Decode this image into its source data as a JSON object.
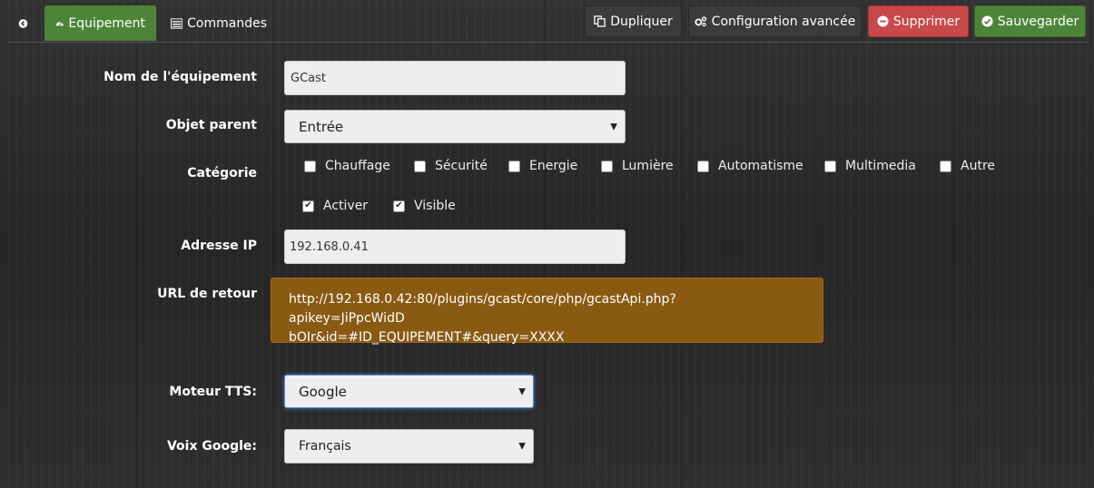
{
  "tabs": {
    "back_label": "",
    "equipment_label": "Equipement",
    "commands_label": "Commandes"
  },
  "toolbar": {
    "duplicate_label": "Dupliquer",
    "advanced_label": "Configuration avancée",
    "delete_label": "Supprimer",
    "save_label": "Sauvegarder"
  },
  "form": {
    "name_label": "Nom de l'équipement",
    "name_value": "GCast",
    "parent_label": "Objet parent",
    "parent_value": "Entrée",
    "category_label": "Catégorie",
    "categories": [
      {
        "label": "Chauffage",
        "checked": false
      },
      {
        "label": "Sécurité",
        "checked": false
      },
      {
        "label": "Energie",
        "checked": false
      },
      {
        "label": "Lumière",
        "checked": false
      },
      {
        "label": "Automatisme",
        "checked": false
      },
      {
        "label": "Multimedia",
        "checked": false
      },
      {
        "label": "Autre",
        "checked": false
      }
    ],
    "activate_label": "Activer",
    "activate_checked": true,
    "visible_label": "Visible",
    "visible_checked": true,
    "ip_label": "Adresse IP",
    "ip_value": "192.168.0.41",
    "url_label": "URL de retour",
    "url_line1": "http://192.168.0.42:80/plugins/gcast/core/php/gcastApi.php?",
    "url_line2_start": "apikey=JiPpcWidD",
    "url_line2_end": "bOIr&id=#ID_EQUIPEMENT#&query=XXXX",
    "tts_label": "Moteur TTS:",
    "tts_value": "Google",
    "voice_label": "Voix Google:",
    "voice_value": "Français"
  },
  "colors": {
    "accent_green": "#4d8538",
    "danger_red": "#c9484a",
    "url_box": "#8a5a12"
  }
}
